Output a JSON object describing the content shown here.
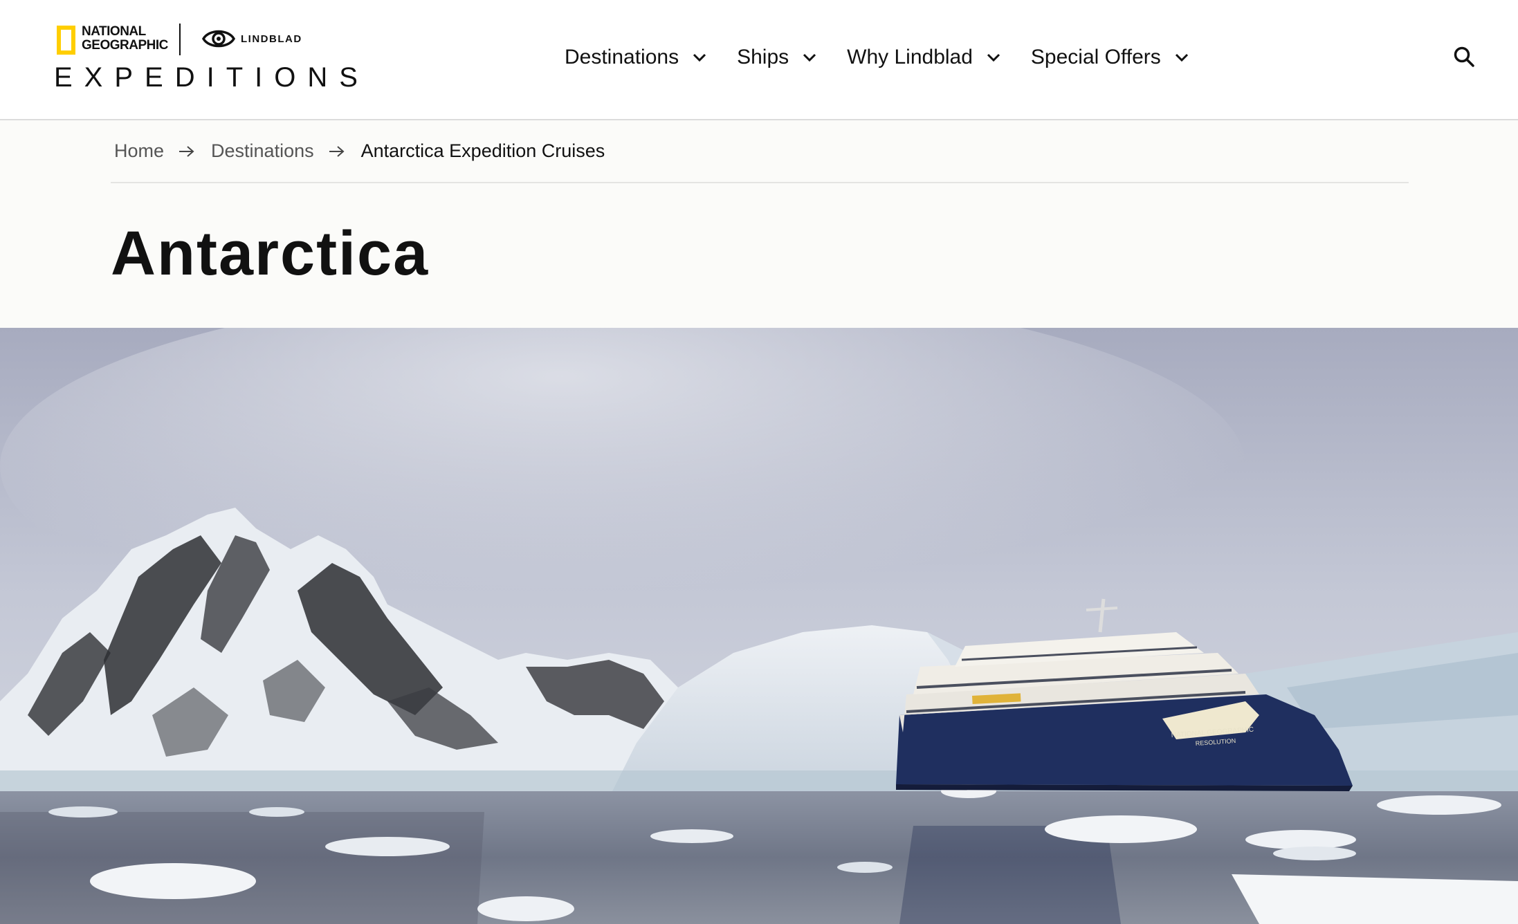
{
  "header": {
    "brand": {
      "ng_line1": "NATIONAL",
      "ng_line2": "GEOGRAPHIC",
      "partner": "LINDBLAD",
      "wordmark": "EXPEDITIONS"
    },
    "nav": [
      {
        "label": "Destinations",
        "icon": "chevron-down-icon"
      },
      {
        "label": "Ships",
        "icon": "chevron-down-icon"
      },
      {
        "label": "Why Lindblad",
        "icon": "chevron-down-icon"
      },
      {
        "label": "Special Offers",
        "icon": "chevron-down-icon"
      }
    ],
    "search_icon": "search-icon"
  },
  "breadcrumb": {
    "items": [
      "Home",
      "Destinations",
      "Antarctica Expedition Cruises"
    ],
    "separator_icon": "arrow-right-icon"
  },
  "page": {
    "title": "Antarctica"
  },
  "hero": {
    "ship_name_line1": "NATIONAL GEOGRAPHIC",
    "ship_name_line2": "RESOLUTION"
  },
  "colors": {
    "brand_yellow": "#ffce00",
    "ship_hull": "#1f2f5f",
    "page_background": "#fbfbf9"
  }
}
